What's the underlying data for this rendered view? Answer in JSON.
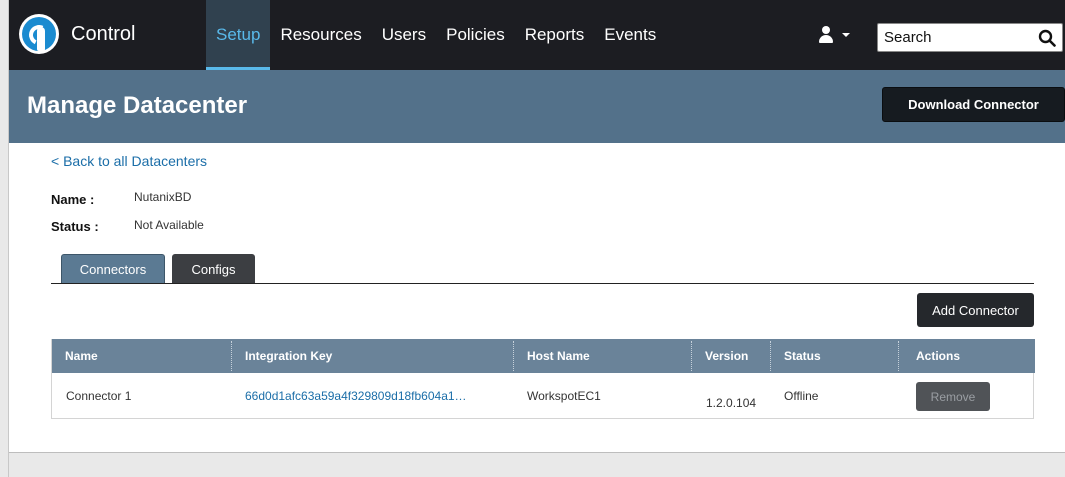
{
  "app": {
    "brand": "Control"
  },
  "nav": {
    "items": [
      {
        "label": "Setup",
        "active": true
      },
      {
        "label": "Resources",
        "active": false
      },
      {
        "label": "Users",
        "active": false
      },
      {
        "label": "Policies",
        "active": false
      },
      {
        "label": "Reports",
        "active": false
      },
      {
        "label": "Events",
        "active": false
      }
    ],
    "user_icon": "user-icon",
    "search_placeholder": "Search",
    "search_icon": "search-icon"
  },
  "header": {
    "title": "Manage Datacenter",
    "download_label": "Download Connector"
  },
  "content": {
    "back_link": "< Back to all Datacenters",
    "name_label": "Name :",
    "name_value": "NutanixBD",
    "status_label": "Status :",
    "status_value": "Not Available",
    "tabs": [
      {
        "label": "Connectors",
        "active": true
      },
      {
        "label": "Configs",
        "active": false
      }
    ],
    "add_connector_label": "Add Connector"
  },
  "table": {
    "columns": [
      "Name",
      "Integration Key",
      "Host Name",
      "Version",
      "Status",
      "Actions"
    ],
    "rows": [
      {
        "name": "Connector 1",
        "integration_key": "66d0d1afc63a59a4f329809d18fb604a1…",
        "host_name": "WorkspotEC1",
        "version": "1.2.0.104",
        "status": "Offline",
        "action_label": "Remove"
      }
    ]
  },
  "colors": {
    "nav_bg": "#1c1d22",
    "active_accent": "#59b9ea",
    "header_bg": "#53718a",
    "table_head": "#6a8399",
    "link": "#1b6ea8"
  }
}
